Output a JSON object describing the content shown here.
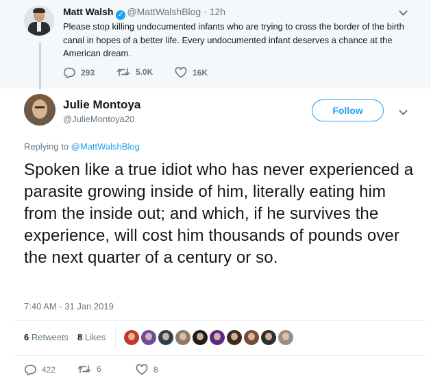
{
  "parent_tweet": {
    "name": "Matt Walsh",
    "handle": "@MattWalshBlog",
    "time": "· 12h",
    "text": "Please stop killing undocumented infants who are trying to cross the border of the birth canal in hopes of a better life. Every undocumented infant deserves a chance at the American dream.",
    "replies": "293",
    "retweets": "5.0K",
    "likes": "16K",
    "verified_color": "#1da1f2"
  },
  "main_tweet": {
    "name": "Julie Montoya",
    "handle": "@JulieMontoya20",
    "follow_label": "Follow",
    "replying_prefix": "Replying to",
    "replying_to": "@MattWalshBlog",
    "text": "Spoken like a true idiot who has never experienced a parasite growing inside of him, literally eating him from the inside out; and which, if he survives the experience, will cost him thousands of pounds over the next quarter of a century or so.",
    "timestamp": "7:40 AM - 31 Jan 2019",
    "retweet_count": "6",
    "retweet_label": "Retweets",
    "like_count": "8",
    "like_label": "Likes",
    "replies": "422",
    "retweets": "6",
    "likes": "8",
    "liker_avatar_colors": [
      "#c0392b",
      "#6d4c9f",
      "#2c3e50",
      "#8a7d6b",
      "#1c1c1c",
      "#5b2a86",
      "#3d2b1f",
      "#7a4b3a",
      "#2f2f2f",
      "#9a8f85"
    ]
  },
  "colors": {
    "accent": "#1da1f2",
    "muted": "#657786",
    "text": "#14171a",
    "parent_bg": "#f5f8fa"
  }
}
